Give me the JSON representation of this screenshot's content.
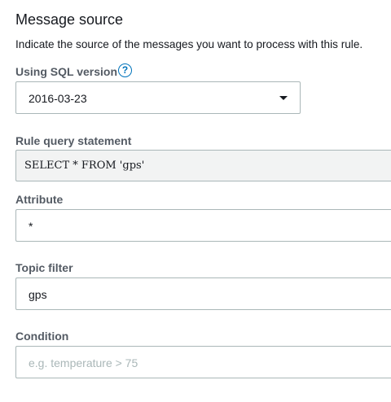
{
  "section": {
    "title": "Message source",
    "description": "Indicate the source of the messages you want to process with this rule."
  },
  "sql_version": {
    "label": "Using SQL version",
    "info_icon": "question-circle-icon",
    "info_glyph": "?",
    "selected": "2016-03-23"
  },
  "rule_query": {
    "label": "Rule query statement",
    "value": "SELECT * FROM 'gps'"
  },
  "attribute": {
    "label": "Attribute",
    "value": "*"
  },
  "topic_filter": {
    "label": "Topic filter",
    "value": "gps"
  },
  "condition": {
    "label": "Condition",
    "placeholder": "e.g. temperature > 75",
    "value": ""
  },
  "colors": {
    "text": "#16191f",
    "label": "#545b64",
    "link": "#0073bb",
    "border": "#aab7b8",
    "readonly_bg": "#f2f3f3"
  }
}
